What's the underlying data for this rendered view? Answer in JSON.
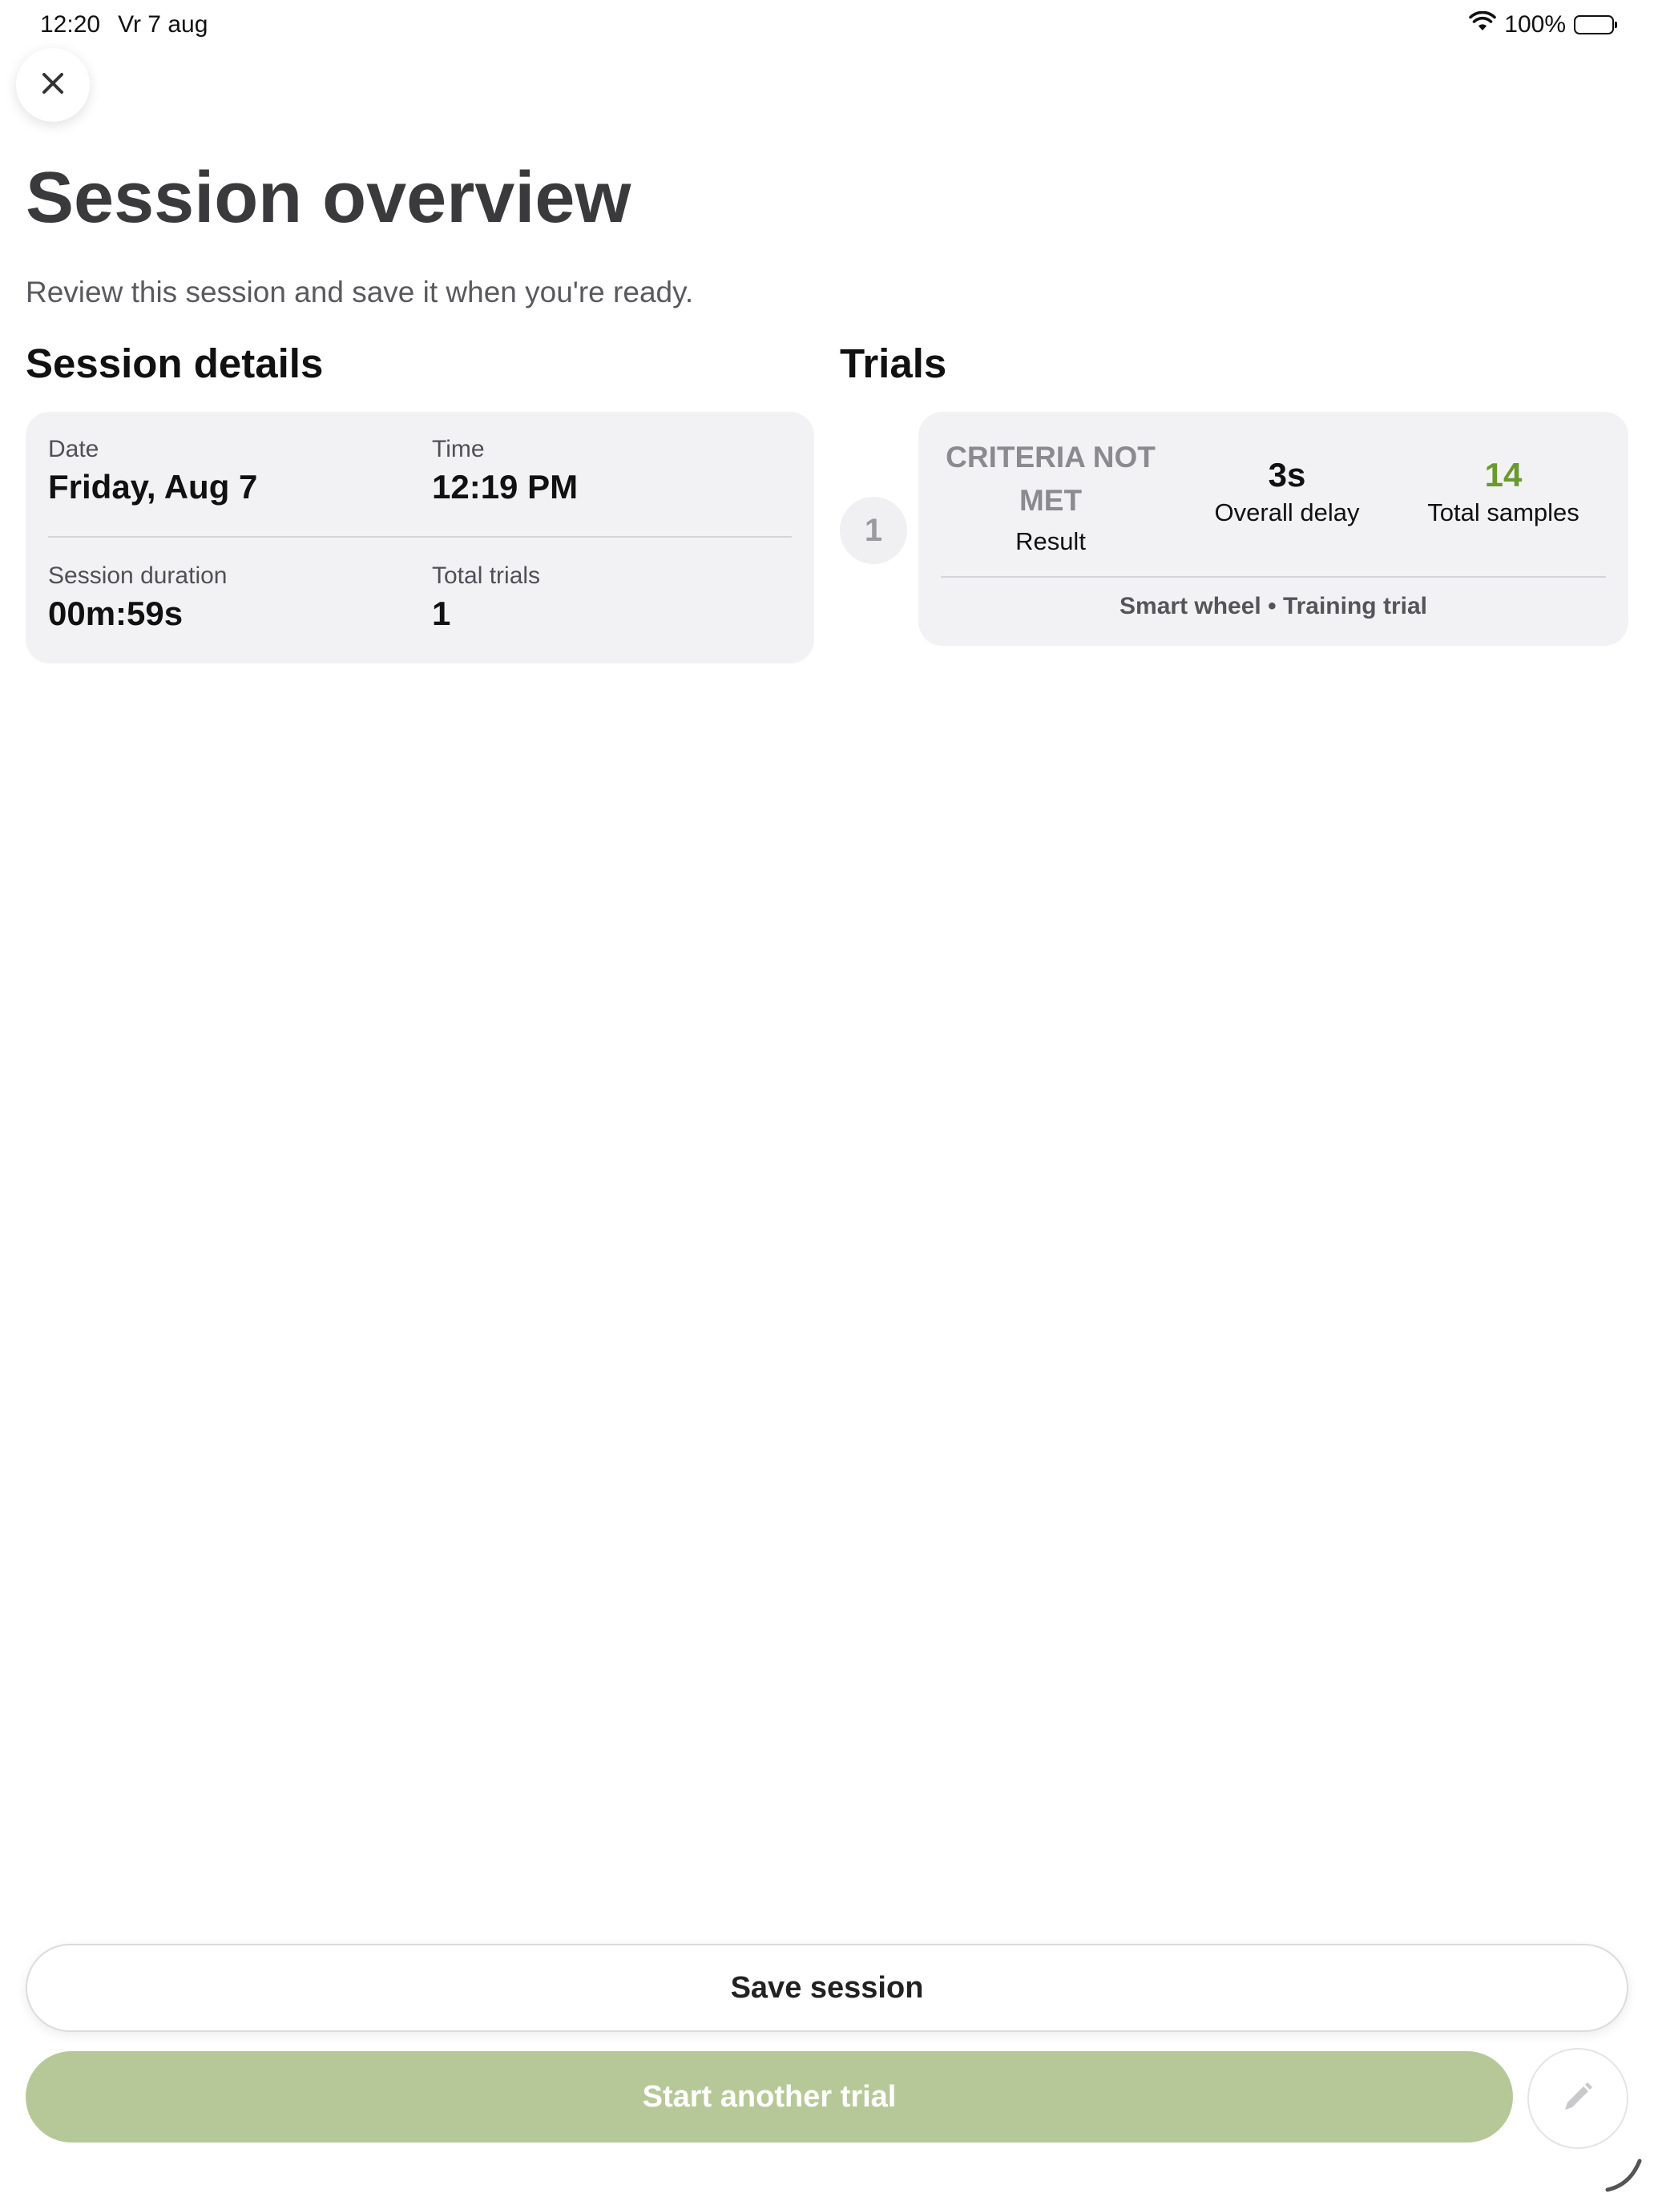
{
  "status_bar": {
    "time": "12:20",
    "date": "Vr 7 aug",
    "battery": "100%",
    "battery_icon": "battery-full-icon",
    "wifi_icon": "wifi-icon"
  },
  "header": {
    "close_icon": "close-icon",
    "title": "Session overview",
    "subtitle": "Review this session and save it when you're ready."
  },
  "session_details": {
    "heading": "Session details",
    "date_label": "Date",
    "date_value": "Friday, Aug 7",
    "time_label": "Time",
    "time_value": "12:19 PM",
    "duration_label": "Session duration",
    "duration_value": "00m:59s",
    "total_trials_label": "Total trials",
    "total_trials_value": "1"
  },
  "trials": {
    "heading": "Trials",
    "items": [
      {
        "number": "1",
        "result_value": "CRITERIA NOT MET",
        "result_label": "Result",
        "delay_value": "3s",
        "delay_label": "Overall delay",
        "samples_value": "14",
        "samples_label": "Total samples",
        "footer": "Smart wheel • Training trial"
      }
    ]
  },
  "actions": {
    "save_label": "Save session",
    "start_label": "Start another trial",
    "edit_icon": "pencil-icon"
  },
  "colors": {
    "accent_green": "#6a9a2e",
    "start_button": "#b7c898",
    "card_background": "#f2f2f4"
  }
}
